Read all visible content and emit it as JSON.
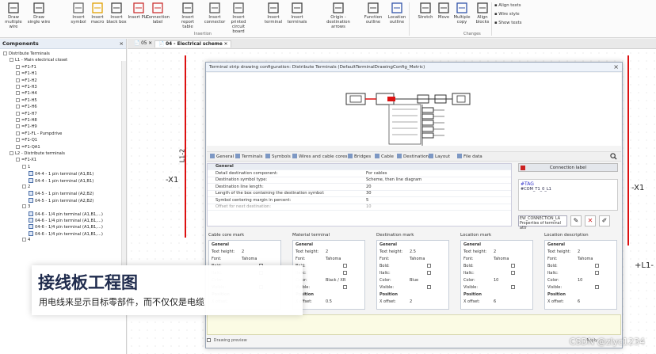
{
  "ribbon": {
    "buttons": [
      {
        "label": "Draw multiple wire"
      },
      {
        "label": "Draw single wire"
      },
      {
        "label": "Insert symbol"
      },
      {
        "label": "Insert macro"
      },
      {
        "label": "Insert black box"
      },
      {
        "label": "Insert PLC"
      },
      {
        "label": "Connection label"
      },
      {
        "label": "Insert report table"
      },
      {
        "label": "Insert connector"
      },
      {
        "label": "Insert printed circuit board"
      },
      {
        "label": "Insert terminal"
      },
      {
        "label": "Insert terminals"
      },
      {
        "label": "Origin - destination arrows"
      },
      {
        "label": "Function outline"
      },
      {
        "label": "Location outline"
      },
      {
        "label": "Stretch"
      },
      {
        "label": "Move"
      },
      {
        "label": "Multiple copy"
      },
      {
        "label": "Align blocks"
      }
    ],
    "small_buttons": [
      "Align texts",
      "Wire style",
      "Show texts"
    ],
    "groups": {
      "insertion": "Insertion",
      "changes": "Changes"
    }
  },
  "components": {
    "title": "Components",
    "tree": [
      {
        "label": "Distribute Terminals",
        "level": 0
      },
      {
        "label": "L1 - Main electrical closet",
        "level": 1
      },
      {
        "label": "=F1-F1",
        "level": 2
      },
      {
        "label": "=F1-H1",
        "level": 2
      },
      {
        "label": "=F1-H2",
        "level": 2
      },
      {
        "label": "=F1-H3",
        "level": 2
      },
      {
        "label": "=F1-H4",
        "level": 2
      },
      {
        "label": "=F1-H5",
        "level": 2
      },
      {
        "label": "=F1-H6",
        "level": 2
      },
      {
        "label": "=F1-H7",
        "level": 2
      },
      {
        "label": "=F1-H8",
        "level": 2
      },
      {
        "label": "=F1-H9",
        "level": 2
      },
      {
        "label": "=F1-FL - Pumpdrive",
        "level": 2
      },
      {
        "label": "=F1-Q1",
        "level": 2
      },
      {
        "label": "=F1-QA1",
        "level": 2
      },
      {
        "label": "L2 - Distribute terminals",
        "level": 1
      },
      {
        "label": "=F1-X1",
        "level": 2
      },
      {
        "label": "1",
        "level": 3
      },
      {
        "label": "04-4 - 1 pin terminal (A1,B1)",
        "level": 4
      },
      {
        "label": "04-4 - 1 pin terminal (A1,B1)",
        "level": 4
      },
      {
        "label": "2",
        "level": 3
      },
      {
        "label": "04-5 - 1 pin terminal (A2,B2)",
        "level": 4
      },
      {
        "label": "04-5 - 1 pin terminal (A2,B2)",
        "level": 4
      },
      {
        "label": "3",
        "level": 3
      },
      {
        "label": "04-6 - 1/4 pin terminal (A1,B1,...)",
        "level": 4
      },
      {
        "label": "04-6 - 1/4 pin terminal (A1,B1,...)",
        "level": 4
      },
      {
        "label": "04-6 - 1/4 pin terminal (A1,B1,...)",
        "level": 4
      },
      {
        "label": "04-6 - 1/4 pin terminal (A1,B1,...)",
        "level": 4
      },
      {
        "label": "4",
        "level": 3
      }
    ]
  },
  "doc_tabs": [
    {
      "label": "05"
    },
    {
      "label": "04 - Electrical scheme"
    }
  ],
  "canvas": {
    "labels": [
      "L1-2",
      "-X1",
      "-X1",
      "+L1-"
    ]
  },
  "dialog": {
    "title": "Terminal strip drawing configuration: Distribute Terminals (DefaultTerminalDrawingConfig_Metric)",
    "tabs": [
      "General",
      "Terminals",
      "Symbols",
      "Wires and cable cores",
      "Bridges",
      "Cable",
      "Destination",
      "Layout",
      "File data"
    ],
    "grid": [
      {
        "k": "General",
        "v": "",
        "type": "hd"
      },
      {
        "k": "Detail destination component:",
        "v": "For cables",
        "type": ""
      },
      {
        "k": "Destination symbol type:",
        "v": "Scheme, then line diagram",
        "type": ""
      },
      {
        "k": "Destination line length:",
        "v": "20",
        "type": ""
      },
      {
        "k": "Length of the box containing the destination symbol:",
        "v": "30",
        "type": ""
      },
      {
        "k": "Symbol centering margin in percent:",
        "v": "5",
        "type": ""
      },
      {
        "k": "Offset for next destination:",
        "v": "10",
        "type": "dis"
      }
    ],
    "connection_label": "Connection label",
    "tag_text": "#TAG",
    "tag_sub": "#COM_T1_0_L1",
    "ew_text": "EW_CONNECTION_LA",
    "ew_sub": "Properties of terminal attr",
    "sections": [
      {
        "title": "Cable core mark",
        "rows": [
          [
            "General",
            ""
          ],
          [
            "Text height:",
            "2"
          ],
          [
            "Font:",
            "Tahoma"
          ],
          [
            "Bold:",
            ""
          ],
          [
            "Italic:",
            ""
          ],
          [
            "Color:",
            ""
          ],
          [
            "Visible:",
            ""
          ],
          [
            "Position",
            ""
          ],
          [
            "X offset:",
            ""
          ]
        ]
      },
      {
        "title": "Material terminal",
        "rows": [
          [
            "General",
            ""
          ],
          [
            "Text height:",
            "2"
          ],
          [
            "Font:",
            "Tahoma"
          ],
          [
            "Bold:",
            ""
          ],
          [
            "Italic:",
            ""
          ],
          [
            "Color:",
            "Black / XR"
          ],
          [
            "Visible:",
            ""
          ],
          [
            "Position",
            ""
          ],
          [
            "X offset:",
            "0.5"
          ]
        ]
      },
      {
        "title": "Destination mark",
        "rows": [
          [
            "General",
            ""
          ],
          [
            "Text height:",
            "2.5"
          ],
          [
            "Font:",
            "Tahoma"
          ],
          [
            "Bold:",
            ""
          ],
          [
            "Italic:",
            ""
          ],
          [
            "Color:",
            "Blue"
          ],
          [
            "Visible:",
            ""
          ],
          [
            "Position",
            ""
          ],
          [
            "X offset:",
            "2"
          ]
        ]
      },
      {
        "title": "Location mark",
        "rows": [
          [
            "General",
            ""
          ],
          [
            "Text height:",
            "2"
          ],
          [
            "Font:",
            "Tahoma"
          ],
          [
            "Bold:",
            ""
          ],
          [
            "Italic:",
            ""
          ],
          [
            "Color:",
            "10"
          ],
          [
            "Visible:",
            ""
          ],
          [
            "Position",
            ""
          ],
          [
            "X offset:",
            "6"
          ]
        ]
      },
      {
        "title": "Location description",
        "rows": [
          [
            "General",
            ""
          ],
          [
            "Text height:",
            "2"
          ],
          [
            "Font:",
            "Tahoma"
          ],
          [
            "Bold:",
            ""
          ],
          [
            "Italic:",
            ""
          ],
          [
            "Color:",
            "10"
          ],
          [
            "Visible:",
            ""
          ],
          [
            "Position",
            ""
          ],
          [
            "X offset:",
            "6"
          ]
        ]
      }
    ],
    "footer_check": "Drawing preview",
    "apply": "Apply"
  },
  "overlay": {
    "title": "接线板工程图",
    "subtitle": "用电线来显示目标零部件，而不仅仅是电缆"
  },
  "watermark": "CSDN @zlyc1234",
  "colors": {
    "accent_red": "#dd1111",
    "tag_blue": "#3344cc"
  }
}
